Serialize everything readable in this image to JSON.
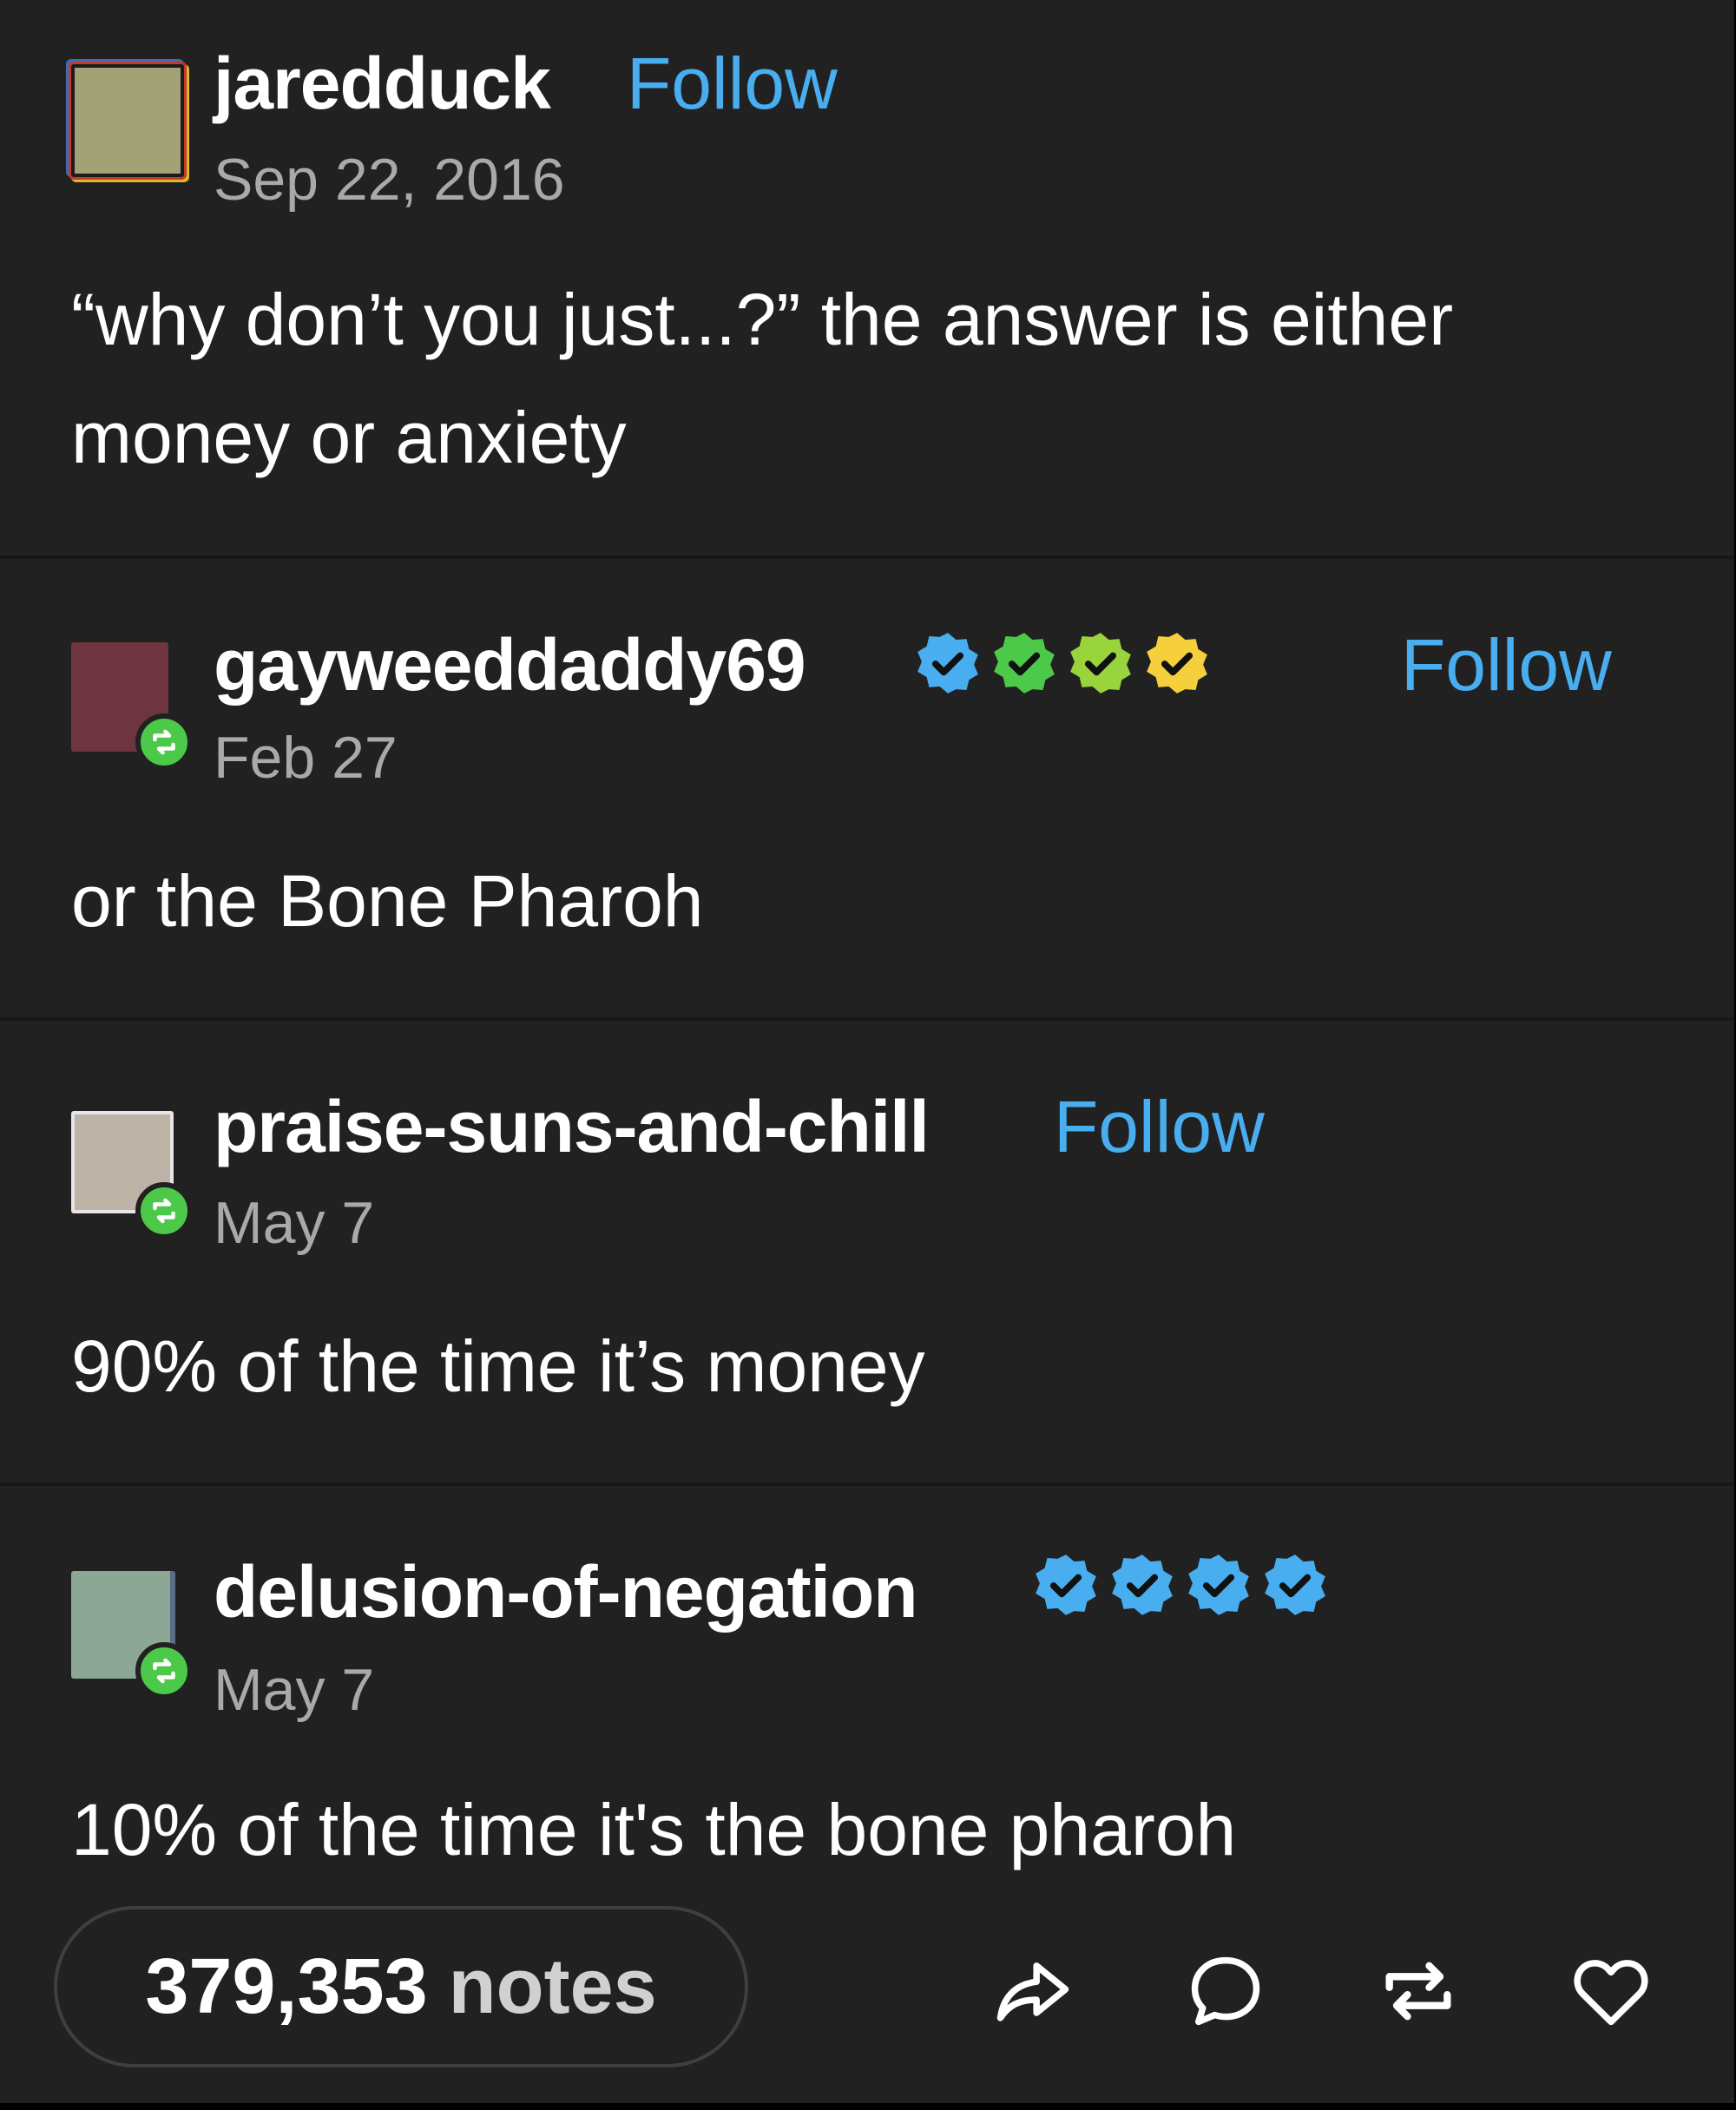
{
  "posts": [
    {
      "username": "jaredduck",
      "follow_label": "Follow",
      "date": "Sep 22, 2016",
      "text": "“why don’t you just...?” the answer is either money or anxiety"
    },
    {
      "username": "gayweeddaddy69",
      "follow_label": "Follow",
      "date": "Feb 27",
      "text": "or the Bone Pharoh",
      "badge_colors": [
        "#48aef0",
        "#4dc94a",
        "#9ad43c",
        "#f5cf3c"
      ]
    },
    {
      "username": "praise-suns-and-chill",
      "follow_label": "Follow",
      "date": "May 7",
      "text": "90% of the time it’s money"
    },
    {
      "username": "delusion-of-negation",
      "date": "May 7",
      "text": "10% of the time it's the bone pharoh",
      "badge_colors": [
        "#48aef0",
        "#48aef0",
        "#48aef0",
        "#48aef0"
      ]
    }
  ],
  "footer": {
    "notes_count": "379,353",
    "notes_label": "notes",
    "actions": [
      "share-icon",
      "reply-icon",
      "reblog-icon",
      "like-icon"
    ]
  },
  "colors": {
    "background": "#212121",
    "follow": "#48aef0",
    "reblog_badge": "#4dc94a",
    "date": "#a9a9a9"
  }
}
